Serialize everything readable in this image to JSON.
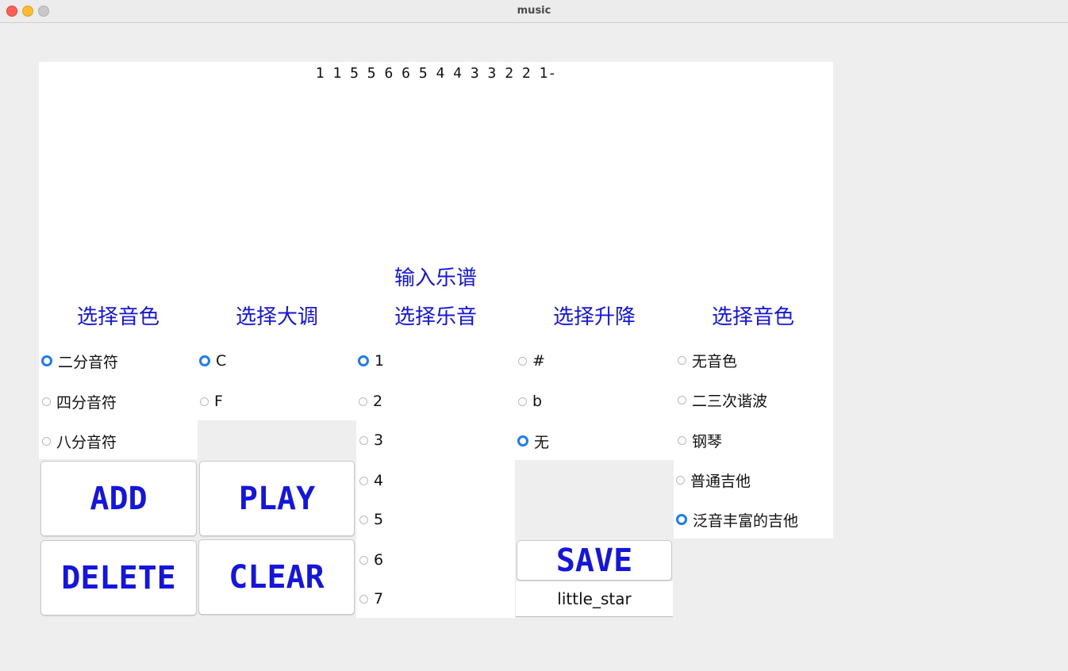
{
  "window": {
    "title": "music"
  },
  "score": {
    "text": "1 1 5 5 6 6 5 4 4 3 3 2 2 1-"
  },
  "input_heading": "输入乐谱",
  "columns": [
    {
      "title": "选择音色",
      "options": [
        {
          "label": "二分音符",
          "selected": true
        },
        {
          "label": "四分音符",
          "selected": false
        },
        {
          "label": "八分音符",
          "selected": false
        }
      ]
    },
    {
      "title": "选择大调",
      "options": [
        {
          "label": "C",
          "selected": true
        },
        {
          "label": "F",
          "selected": false
        }
      ]
    },
    {
      "title": "选择乐音",
      "options": [
        {
          "label": "1",
          "selected": true
        },
        {
          "label": "2",
          "selected": false
        },
        {
          "label": "3",
          "selected": false
        },
        {
          "label": "4",
          "selected": false
        },
        {
          "label": "5",
          "selected": false
        },
        {
          "label": "6",
          "selected": false
        },
        {
          "label": "7",
          "selected": false
        }
      ]
    },
    {
      "title": "选择升降",
      "options": [
        {
          "label": "#",
          "selected": false
        },
        {
          "label": "b",
          "selected": false
        },
        {
          "label": "无",
          "selected": true
        }
      ]
    },
    {
      "title": "选择音色",
      "options": [
        {
          "label": "无音色",
          "selected": false
        },
        {
          "label": "二三次谐波",
          "selected": false
        },
        {
          "label": "钢琴",
          "selected": false
        },
        {
          "label": "普通吉他",
          "selected": false
        },
        {
          "label": "泛音丰富的吉他",
          "selected": true
        }
      ]
    }
  ],
  "buttons": {
    "add": "ADD",
    "play": "PLAY",
    "delete": "DELETE",
    "clear": "CLEAR",
    "save": "SAVE"
  },
  "filename": {
    "value": "little_star"
  },
  "colors": {
    "accent": "#1515e0",
    "radio_selected": "#1d7cf2"
  }
}
